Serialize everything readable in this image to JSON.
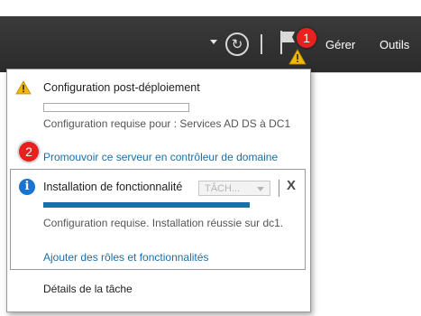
{
  "toolbar": {
    "menu_manage": "Gérer",
    "menu_tools": "Outils",
    "refresh_glyph": "↻",
    "flag_icon": "flag-icon",
    "warning_icon": "warning-icon"
  },
  "callouts": {
    "one": "1",
    "two": "2"
  },
  "popup": {
    "post_deploy": {
      "title": "Configuration post-déploiement",
      "requirement": "Configuration requise pour : Services AD DS à DC1",
      "link": "Promouvoir ce serveur en contrôleur de domaine"
    },
    "feature_install": {
      "title": "Installation de fonctionnalité",
      "task_select": "TÂCH...",
      "close": "X",
      "status": "Configuration requise. Installation réussie sur dc1.",
      "link": "Ajouter des rôles et fonctionnalités",
      "progress": 1.0
    },
    "task_details": "Détails de la tâche"
  },
  "colors": {
    "toolbar_bg": "#2f2f2f",
    "link": "#1a6fa8",
    "progress": "#1d6ea3",
    "badge": "#e8201e",
    "warning": "#f2b705",
    "info": "#1a73d1"
  }
}
